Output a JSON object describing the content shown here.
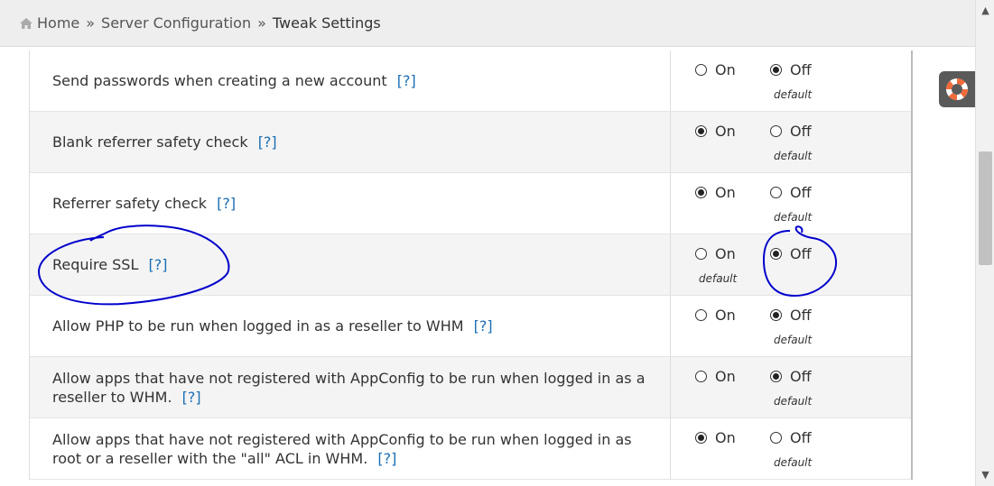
{
  "breadcrumb": {
    "home": "Home",
    "sep1": "»",
    "section": "Server Configuration",
    "sep2": "»",
    "current": "Tweak Settings"
  },
  "help_link": "[?]",
  "on_label": "On",
  "off_label": "Off",
  "default_label": "default",
  "settings": [
    {
      "label": "Send passwords when creating a new account",
      "selected": "off",
      "default": "off"
    },
    {
      "label": "Blank referrer safety check",
      "selected": "on",
      "default": "off"
    },
    {
      "label": "Referrer safety check",
      "selected": "on",
      "default": "off"
    },
    {
      "label": "Require SSL",
      "selected": "off",
      "default": "on"
    },
    {
      "label": "Allow PHP to be run when logged in as a reseller to WHM",
      "selected": "off",
      "default": "off"
    },
    {
      "label": "Allow apps that have not registered with AppConfig to be run when logged in as a reseller to WHM.",
      "selected": "off",
      "default": "off"
    },
    {
      "label": "Allow apps that have not registered with AppConfig to be run when logged in as root or a reseller with the \"all\" ACL in WHM.",
      "selected": "on",
      "default": "off"
    }
  ],
  "colors": {
    "link": "#1a6fb5",
    "annotation": "#0000cc"
  }
}
